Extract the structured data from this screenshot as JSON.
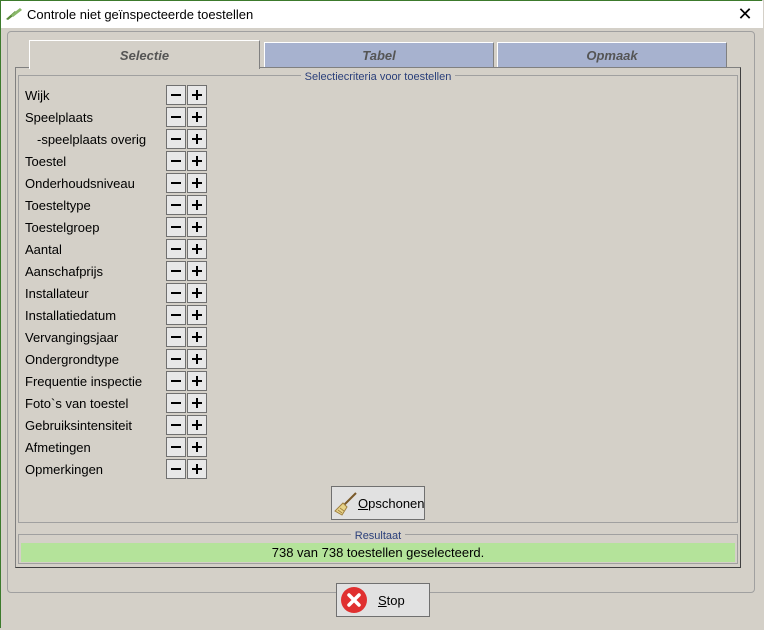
{
  "window": {
    "title": "Controle niet geïnspecteerde toestellen",
    "close_glyph": "✕"
  },
  "tabs": [
    {
      "label": "Selectie",
      "active": true
    },
    {
      "label": "Tabel",
      "active": false
    },
    {
      "label": "Opmaak",
      "active": false
    }
  ],
  "criteria": {
    "caption": "Selectiecriteria voor toestellen",
    "items": [
      {
        "label": "Wijk"
      },
      {
        "label": "Speelplaats"
      },
      {
        "label": "-speelplaats overig"
      },
      {
        "label": "Toestel"
      },
      {
        "label": "Onderhoudsniveau"
      },
      {
        "label": "Toesteltype"
      },
      {
        "label": "Toestelgroep"
      },
      {
        "label": "Aantal"
      },
      {
        "label": "Aanschafprijs"
      },
      {
        "label": "Installateur"
      },
      {
        "label": "Installatiedatum"
      },
      {
        "label": "Vervangingsjaar"
      },
      {
        "label": "Ondergrondtype"
      },
      {
        "label": "Frequentie inspectie"
      },
      {
        "label": "Foto`s van toestel"
      },
      {
        "label": "Gebruiksintensiteit"
      },
      {
        "label": "Afmetingen"
      },
      {
        "label": "Opmerkingen"
      }
    ],
    "minus_icon": "minus-icon",
    "plus_icon": "plus-icon"
  },
  "opschonen": {
    "label_first": "O",
    "label_rest": "pschonen",
    "icon": "broom-icon"
  },
  "result": {
    "caption": "Resultaat",
    "text": "738 van 738 toestellen geselecteerd.",
    "color": "#b4e39a"
  },
  "stop": {
    "label_first": "S",
    "label_rest": "top",
    "icon": "stop-icon",
    "icon_color": "#e03030"
  }
}
